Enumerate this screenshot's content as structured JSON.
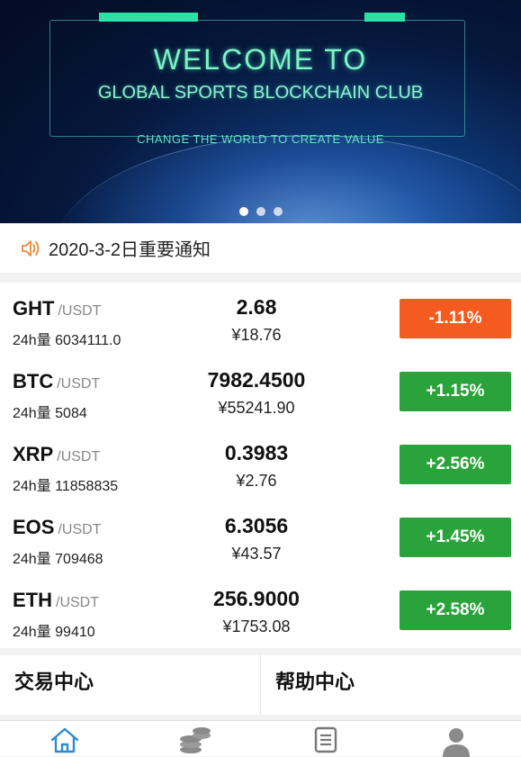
{
  "banner": {
    "title": "WELCOME TO",
    "subtitle": "GLOBAL SPORTS BLOCKCHAIN CLUB",
    "slogan": "CHANGE THE WORLD TO CREATE VALUE",
    "slide_count": 3,
    "active_slide": 1
  },
  "notice": {
    "icon": "speaker-icon",
    "text": "2020-3-2日重要通知"
  },
  "market": {
    "rows": [
      {
        "symbol": "GHT",
        "pair": "/USDT",
        "volume": "24h量 6034111.0",
        "price": "2.68",
        "cny": "¥18.76",
        "change": "-1.11%",
        "dir": "down"
      },
      {
        "symbol": "BTC",
        "pair": "/USDT",
        "volume": "24h量 5084",
        "price": "7982.4500",
        "cny": "¥55241.90",
        "change": "+1.15%",
        "dir": "up"
      },
      {
        "symbol": "XRP",
        "pair": "/USDT",
        "volume": "24h量 11858835",
        "price": "0.3983",
        "cny": "¥2.76",
        "change": "+2.56%",
        "dir": "up"
      },
      {
        "symbol": "EOS",
        "pair": "/USDT",
        "volume": "24h量 709468",
        "price": "6.3056",
        "cny": "¥43.57",
        "change": "+1.45%",
        "dir": "up"
      },
      {
        "symbol": "ETH",
        "pair": "/USDT",
        "volume": "24h量 99410",
        "price": "256.9000",
        "cny": "¥1753.08",
        "change": "+2.58%",
        "dir": "up"
      }
    ],
    "colors": {
      "up": "#2aa43a",
      "down": "#f55a1e"
    }
  },
  "cards": {
    "trade_center": "交易中心",
    "help_center": "帮助中心"
  },
  "tabbar": {
    "tabs": [
      {
        "icon": "home-icon",
        "active": true
      },
      {
        "icon": "coins-icon",
        "active": false
      },
      {
        "icon": "document-icon",
        "active": false
      },
      {
        "icon": "user-icon",
        "active": false
      }
    ],
    "accent": "#2a8bd8"
  }
}
